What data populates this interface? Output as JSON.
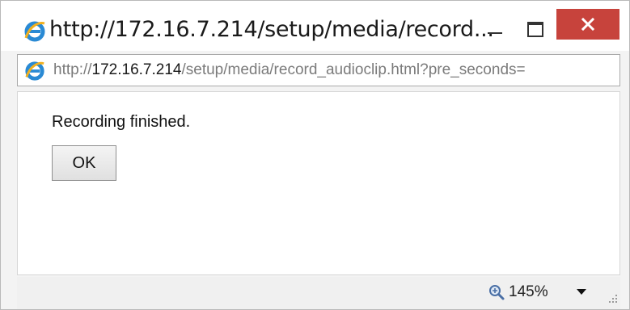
{
  "window": {
    "title": "http://172.16.7.214/setup/media/record...",
    "controls": {
      "minimize_icon": "minimize-icon",
      "maximize_icon": "maximize-icon",
      "close_icon": "close-icon",
      "close_color": "#c7433c"
    }
  },
  "address_bar": {
    "scheme": "http://",
    "host": "172.16.7.214",
    "path": "/setup/media/record_audioclip.html?pre_seconds=",
    "icon": "internet-explorer-icon"
  },
  "content": {
    "message": "Recording finished.",
    "ok_label": "OK"
  },
  "status_bar": {
    "zoom_icon": "zoom-icon",
    "zoom_level": "145%",
    "dropdown_icon": "chevron-down-icon"
  }
}
